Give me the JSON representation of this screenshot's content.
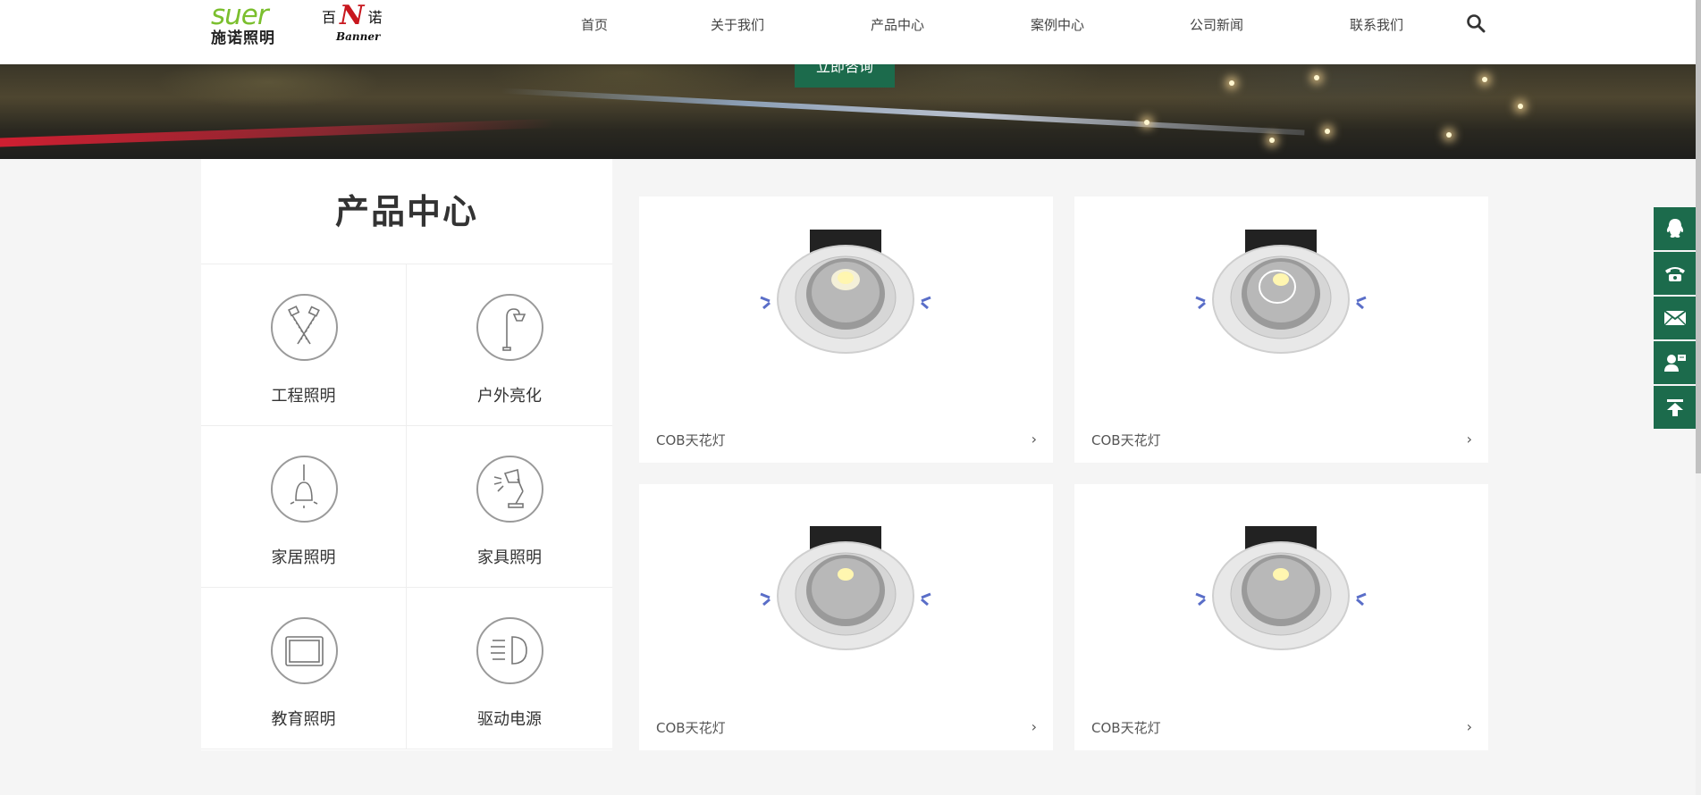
{
  "header": {
    "logo_suer_word": "suer",
    "logo_suer_cn": "施诺照明",
    "logo_banner_cn_left": "百",
    "logo_banner_n": "N",
    "logo_banner_cn_right": "诺",
    "logo_banner_en": "Banner",
    "nav": [
      "首页",
      "关于我们",
      "产品中心",
      "案例中心",
      "公司新闻",
      "联系我们"
    ]
  },
  "banner": {
    "consult_label": "立即咨询"
  },
  "categories": {
    "title": "产品中心",
    "items": [
      {
        "label": "工程照明",
        "icon": "spotlights-icon"
      },
      {
        "label": "户外亮化",
        "icon": "street-lamp-icon"
      },
      {
        "label": "家居照明",
        "icon": "pendant-lamp-icon"
      },
      {
        "label": "家具照明",
        "icon": "desk-lamp-icon"
      },
      {
        "label": "教育照明",
        "icon": "panel-light-icon"
      },
      {
        "label": "驱动电源",
        "icon": "headlight-icon"
      }
    ]
  },
  "products": [
    {
      "name": "COB天花灯",
      "arrow": "›"
    },
    {
      "name": "COB天花灯",
      "arrow": "›"
    },
    {
      "name": "COB天花灯",
      "arrow": "›"
    },
    {
      "name": "COB天花灯",
      "arrow": "›"
    }
  ],
  "sidebar": [
    "qq-icon",
    "phone-icon",
    "mail-icon",
    "contact-card-icon",
    "back-to-top-icon"
  ],
  "colors": {
    "accent": "#1c6b4c",
    "logo_green": "#7bbf2e",
    "logo_red": "#c8171e"
  }
}
